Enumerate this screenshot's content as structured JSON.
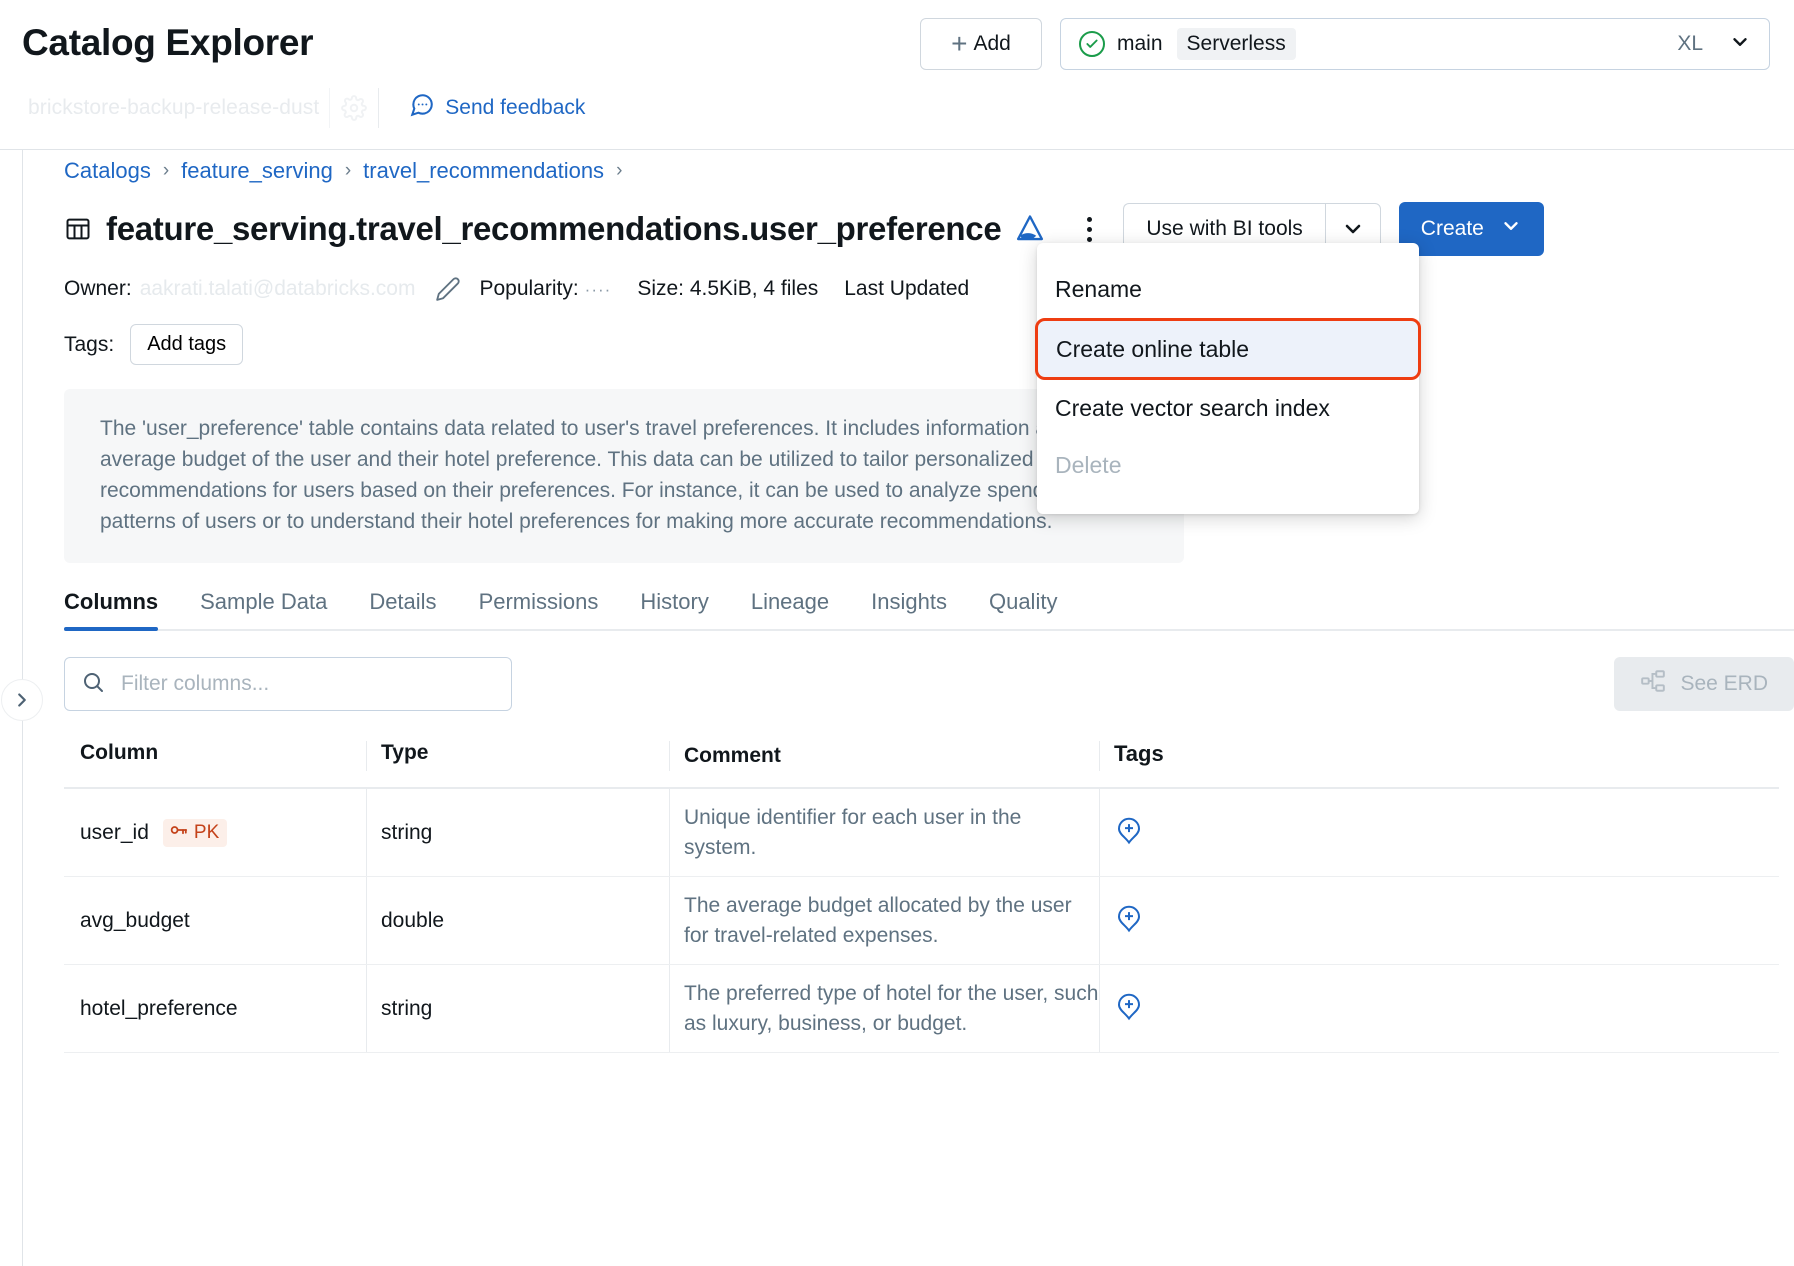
{
  "header": {
    "app_title": "Catalog Explorer",
    "workspace_name": "brickstore-backup-release-dust",
    "gear_icon": "gear-icon",
    "feedback_label": "Send feedback",
    "feedback_icon": "comment-icon",
    "add_label": "Add",
    "add_icon": "plus-icon",
    "cluster": {
      "status_icon": "check-circle-icon",
      "name": "main",
      "badge": "Serverless",
      "size": "XL",
      "caret_icon": "chevron-down-icon"
    }
  },
  "breadcrumb": {
    "items": [
      "Catalogs",
      "feature_serving",
      "travel_recommendations"
    ],
    "separator": "›",
    "trailing_separator": "›"
  },
  "title": {
    "icon": "table-icon",
    "text": "feature_serving.travel_recommendations.user_preference",
    "format_icon": "delta-lake-icon",
    "kebab_icon": "kebab-menu-icon"
  },
  "actions": {
    "bi_tools_label": "Use with BI tools",
    "bi_tools_caret_icon": "chevron-down-icon",
    "create_label": "Create",
    "create_caret_icon": "chevron-down-icon"
  },
  "menu": {
    "items": [
      {
        "label": "Rename",
        "state": "normal"
      },
      {
        "label": "Create online table",
        "state": "highlighted"
      },
      {
        "label": "Create vector search index",
        "state": "normal"
      },
      {
        "label": "Delete",
        "state": "disabled"
      }
    ],
    "highlight_color": "#EE3D11",
    "highlight_bg": "#EDF2FA"
  },
  "meta": {
    "owner_label": "Owner:",
    "owner_value": "aakrati.talati@databricks.com",
    "edit_icon": "pencil-icon",
    "popularity_label": "Popularity:",
    "popularity_value": "····",
    "size_label": "Size: 4.5KiB, 4 files",
    "last_updated_label": "Last Updated"
  },
  "tags": {
    "label": "Tags:",
    "add_button": "Add tags"
  },
  "description": "The 'user_preference' table contains data related to user's travel preferences. It includes information about the average budget of the user and their hotel preference. This data can be utilized to tailor personalized travel recommendations for users based on their preferences. For instance, it can be used to analyze spending patterns of users or to understand their hotel preferences for making more accurate recommendations.",
  "tabs": [
    {
      "label": "Columns",
      "active": true
    },
    {
      "label": "Sample Data",
      "active": false
    },
    {
      "label": "Details",
      "active": false
    },
    {
      "label": "Permissions",
      "active": false
    },
    {
      "label": "History",
      "active": false
    },
    {
      "label": "Lineage",
      "active": false
    },
    {
      "label": "Insights",
      "active": false
    },
    {
      "label": "Quality",
      "active": false
    }
  ],
  "filter": {
    "placeholder": "Filter columns...",
    "value": "",
    "search_icon": "search-icon"
  },
  "erd": {
    "label": "See ERD",
    "icon": "erd-diagram-icon",
    "disabled": true
  },
  "table": {
    "headers": [
      "Column",
      "Type",
      "Comment",
      "Tags"
    ],
    "rows": [
      {
        "column": "user_id",
        "badge": "PK",
        "badge_icon": "key-icon",
        "type": "string",
        "comment": "Unique identifier for each user in the system.",
        "tag_icon": "add-tag-icon"
      },
      {
        "column": "avg_budget",
        "badge": "",
        "badge_icon": "",
        "type": "double",
        "comment": "The average budget allocated by the user for travel-related expenses.",
        "tag_icon": "add-tag-icon"
      },
      {
        "column": "hotel_preference",
        "badge": "",
        "badge_icon": "",
        "type": "string",
        "comment": "The preferred type of hotel for the user, such as luxury, business, or budget.",
        "tag_icon": "add-tag-icon"
      }
    ]
  },
  "rail": {
    "toggle_icon": "chevron-right-icon"
  },
  "colors": {
    "accent_blue": "#1F67C4",
    "highlight_red": "#EE3D11",
    "success_green": "#1B9C4A",
    "pk_orange": "#C4421A"
  }
}
